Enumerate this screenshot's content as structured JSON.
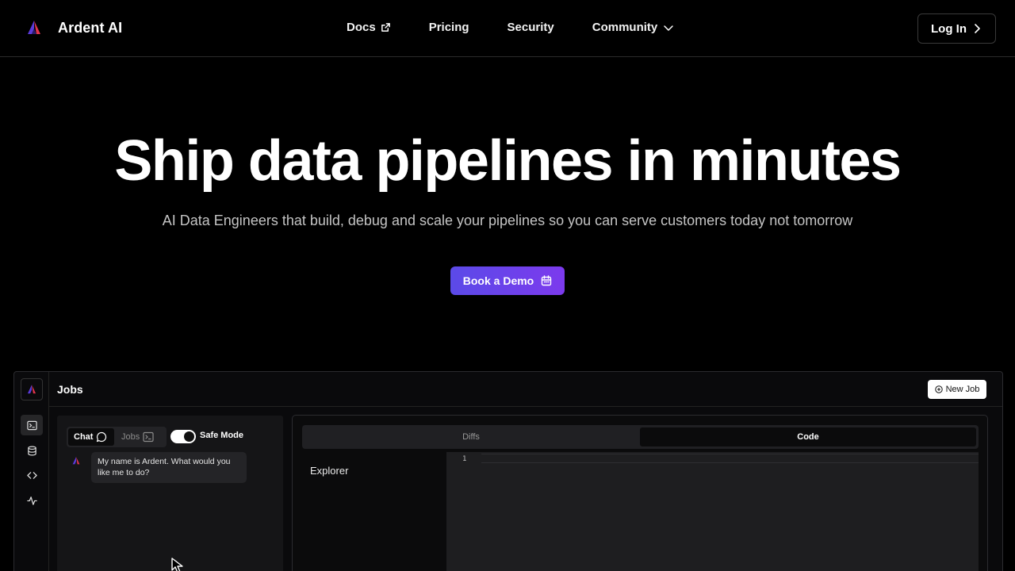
{
  "brand": {
    "name": "Ardent AI"
  },
  "nav": {
    "links": [
      {
        "label": "Docs",
        "icon": "external-link-icon"
      },
      {
        "label": "Pricing"
      },
      {
        "label": "Security"
      },
      {
        "label": "Community",
        "icon": "chevron-down-icon"
      }
    ],
    "login_label": "Log In"
  },
  "hero": {
    "title": "Ship data pipelines in minutes",
    "subtitle": "AI Data Engineers that build, debug and scale your pipelines so you can serve customers today not tomorrow",
    "cta_label": "Book a Demo"
  },
  "app": {
    "title": "Jobs",
    "new_job_label": "New Job",
    "chat": {
      "tab_chat": "Chat",
      "tab_jobs": "Jobs",
      "toggle_label": "Safe Mode",
      "message": "My name is Ardent. What would you like me to do?"
    },
    "editor": {
      "tab_diffs": "Diffs",
      "tab_code": "Code",
      "explorer_label": "Explorer",
      "line_number": "1"
    }
  },
  "colors": {
    "accent_start": "#5b4ae8",
    "accent_end": "#7c3aed",
    "logo_red": "#e0344c"
  }
}
